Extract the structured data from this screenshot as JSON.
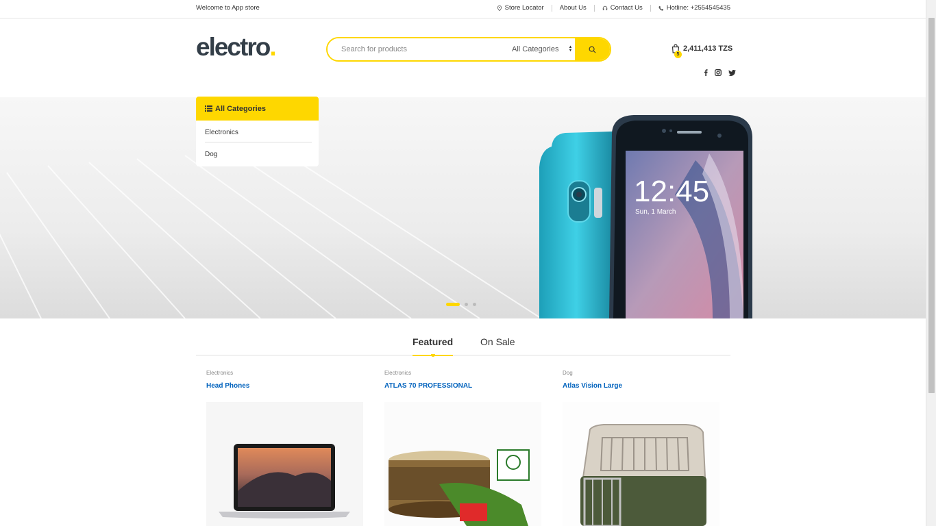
{
  "topbar": {
    "welcome": "Welcome to App store",
    "store_locator": "Store Locator",
    "about_us": "About Us",
    "contact_us": "Contact Us",
    "hotline": "Hotline: +2554545435"
  },
  "header": {
    "logo_text": "electro",
    "logo_dot": ".",
    "search_placeholder": "Search for products",
    "category_select": "All Categories",
    "cart_count": "5",
    "cart_total": "2,411,413 TZS"
  },
  "category_menu": {
    "title": "All Categories",
    "items": [
      "Electronics",
      "Dog"
    ]
  },
  "hero": {
    "slide_count": 3,
    "active_slide": 1,
    "phone_time": "12:45",
    "phone_date": "Sun, 1 March"
  },
  "tabs": {
    "featured": "Featured",
    "on_sale": "On Sale"
  },
  "products": [
    {
      "category": "Electronics",
      "name": "Head Phones"
    },
    {
      "category": "Electronics",
      "name": "ATLAS 70 PROFESSIONAL"
    },
    {
      "category": "Dog",
      "name": "Atlas Vision Large"
    }
  ],
  "colors": {
    "accent": "#fed700",
    "link": "#0062bd",
    "text": "#333e48"
  }
}
